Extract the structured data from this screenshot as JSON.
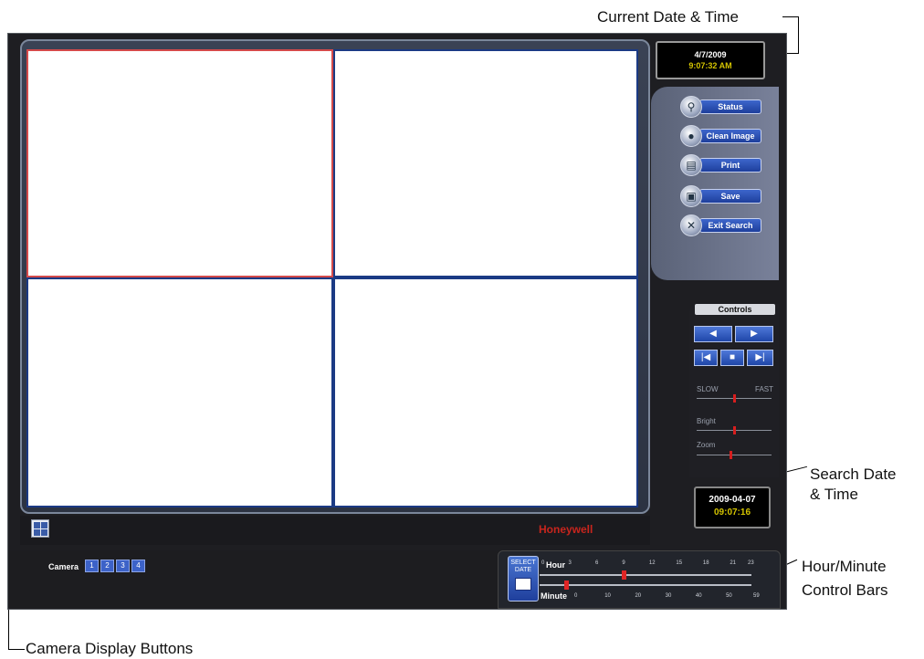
{
  "annotations": {
    "current_date_time": "Current Date & Time",
    "search_date_time": [
      "Search Date",
      "& Time"
    ],
    "hour_minute_bars": [
      "Hour/Minute",
      "Control Bars"
    ],
    "camera_display_buttons": "Camera Display Buttons"
  },
  "clock": {
    "date": "4/7/2009",
    "time": "9:07:32 AM"
  },
  "buttons": {
    "status": "Status",
    "clean_image": "Clean Image",
    "print": "Print",
    "save": "Save",
    "exit_search": "Exit Search"
  },
  "controls": {
    "title": "Controls",
    "speed_slow": "SLOW",
    "speed_fast": "FAST",
    "bright": "Bright",
    "zoom": "Zoom",
    "speed_level": 0.5,
    "bright_level": 0.5,
    "zoom_level": 0.45
  },
  "search": {
    "date": "2009-04-07",
    "time": "09:07:16"
  },
  "brand": "Honeywell",
  "camera": {
    "label": "Camera",
    "buttons": [
      "1",
      "2",
      "3",
      "4"
    ]
  },
  "timebar": {
    "select_date": [
      "SELECT",
      "DATE"
    ],
    "hour_label": "Hour",
    "minute_label": "Minute",
    "hour_ticks": [
      "0",
      "3",
      "6",
      "9",
      "12",
      "15",
      "18",
      "21",
      "23"
    ],
    "minute_ticks": [
      "0",
      "10",
      "20",
      "30",
      "40",
      "50",
      "59"
    ],
    "hour_value": 9,
    "minute_value": 7
  },
  "colors": {
    "selected_cell_border": "#d44a4a",
    "cell_border": "#1b3a84",
    "accent_button": "#2d55bf",
    "brand_red": "#c8251d",
    "time_yellow": "#d4c400"
  },
  "icons": {
    "status": "magnifier-icon",
    "clean_image": "image-clean-icon",
    "print": "printer-icon",
    "save": "floppy-icon",
    "exit_search": "close-icon"
  }
}
